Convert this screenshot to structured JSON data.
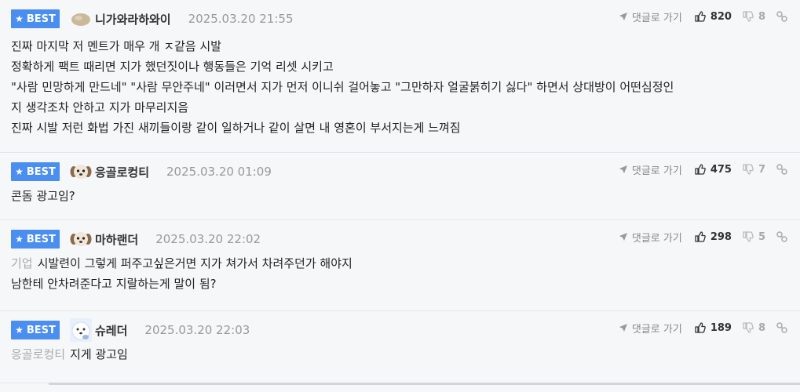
{
  "labels": {
    "best": "BEST",
    "reply_to": "댓글로 가기"
  },
  "comments": [
    {
      "nick": "니가와라하와이",
      "date": "2025.03.20 21:55",
      "likes": "820",
      "dislikes": "8",
      "avatar": "blob-avatar",
      "mention": "",
      "lines": [
        "진짜 마지막 저 멘트가 매우 개 ㅈ같음 시발",
        "정확하게 팩트 때리면 지가 했던짓이나 행동들은 기억 리셋 시키고",
        "\"사람 민망하게 만드네\" \"사람 무안주네\" 이러면서 지가 먼저 이니쉬 걸어놓고 \"그만하자 얼굴붉히기 싫다\" 하면서 상대방이 어떤심정인",
        "지 생각조차 안하고 지가 마무리지음",
        "진짜 시발 저런 화법 가진 새끼들이랑 같이 일하거나 같이 살면 내 영혼이 부서지는게 느껴짐"
      ]
    },
    {
      "nick": "응골로컹티",
      "date": "2025.03.20 01:09",
      "likes": "475",
      "dislikes": "7",
      "avatar": "puppy-avatar",
      "mention": "",
      "lines": [
        "콘돔 광고임?"
      ]
    },
    {
      "nick": "마하랜더",
      "date": "2025.03.20 22:02",
      "likes": "298",
      "dislikes": "5",
      "avatar": "puppy-avatar",
      "mention": "기업",
      "lines": [
        "시발련이 그렇게 퍼주고싶은거면 지가 쳐가서 차려주던가 해야지",
        "남한테 안차려준다고 지랄하는게 말이 됨?"
      ]
    },
    {
      "nick": "슈레더",
      "date": "2025.03.20 22:03",
      "likes": "189",
      "dislikes": "8",
      "avatar": "white-dog-avatar",
      "mention": "응골로컹티",
      "lines": [
        "지게 광고임"
      ]
    }
  ]
}
